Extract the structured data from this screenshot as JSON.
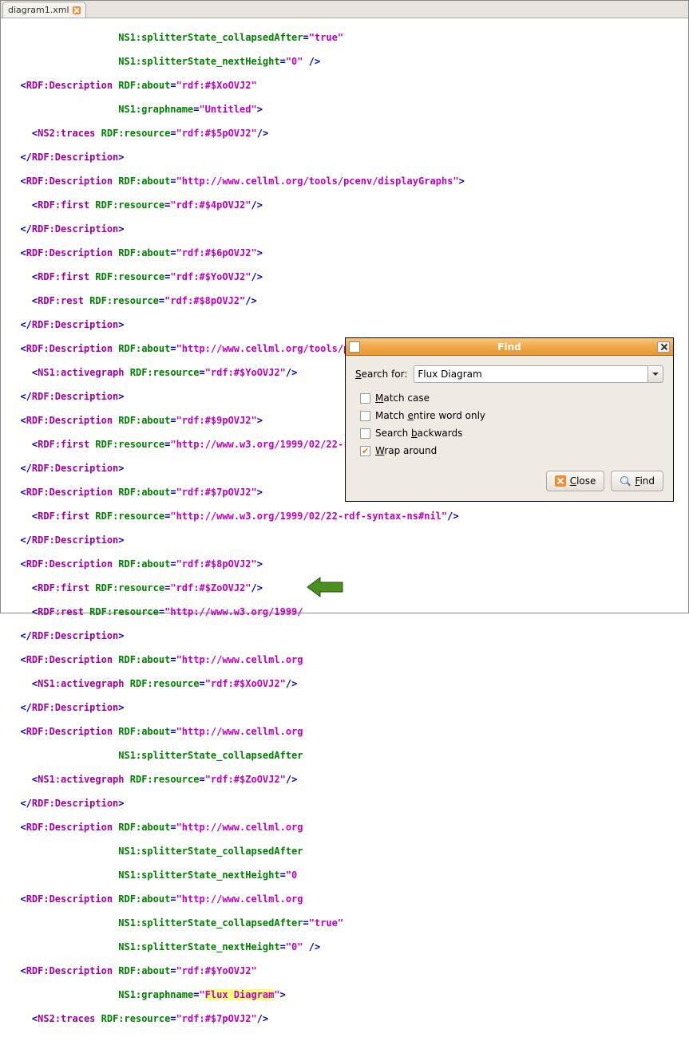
{
  "tab": {
    "label": "diagram1.xml"
  },
  "code": {
    "l1_a": "NS1:splitterState_collapsedAfter",
    "l1_v": "\"true\"",
    "l2_a": "NS1:splitterState_nextHeight",
    "l2_v": "\"0\"",
    "l3_t": "RDF:Description",
    "l3_a": "RDF:about",
    "l3_v": "\"rdf:#$XoOVJ2\"",
    "l4_a": "NS1:graphname",
    "l4_v": "\"Untitled\"",
    "l5_t": "NS2:traces",
    "l5_a": "RDF:resource",
    "l5_v": "\"rdf:#$5pOVJ2\"",
    "l6_t": "RDF:Description",
    "l7_t": "RDF:Description",
    "l7_a": "RDF:about",
    "l7_v": "\"http://www.cellml.org/tools/pcenv/displayGraphs\"",
    "l8_t": "RDF:first",
    "l8_a": "RDF:resource",
    "l8_v": "\"rdf:#$4pOVJ2\"",
    "l9_t": "RDF:Description",
    "l10_t": "RDF:Description",
    "l10_a": "RDF:about",
    "l10_v": "\"rdf:#$6pOVJ2\"",
    "l11_t": "RDF:first",
    "l11_a": "RDF:resource",
    "l11_v": "\"rdf:#$YoOVJ2\"",
    "l12_t": "RDF:rest",
    "l12_a": "RDF:resource",
    "l12_v": "\"rdf:#$8pOVJ2\"",
    "l13_t": "RDF:Description",
    "l14_t": "RDF:Description",
    "l14_a": "RDF:about",
    "l14_v": "\"http://www.cellml.org/tools/pcenv/splitter/graph_sel_graph2\"",
    "l15_t": "NS1:activegraph",
    "l15_a": "RDF:resource",
    "l15_v": "\"rdf:#$YoOVJ2\"",
    "l16_t": "RDF:Description",
    "l17_t": "RDF:Description",
    "l17_a": "RDF:about",
    "l17_v": "\"rdf:#$9pOVJ2\"",
    "l18_t": "RDF:first",
    "l18_a": "RDF:resource",
    "l18_v": "\"http://www.w3.org/1999/02/22-rdf-syntax-ns#nil\"",
    "l19_t": "RDF:Description",
    "l20_t": "RDF:Description",
    "l20_a": "RDF:about",
    "l20_v": "\"rdf:#$7pOVJ2\"",
    "l21_t": "RDF:first",
    "l21_a": "RDF:resource",
    "l21_v": "\"http://www.w3.org/1999/02/22-rdf-syntax-ns#nil\"",
    "l22_t": "RDF:Description",
    "l23_t": "RDF:Description",
    "l23_a": "RDF:about",
    "l23_v": "\"rdf:#$8pOVJ2\"",
    "l24_t": "RDF:first",
    "l24_a": "RDF:resource",
    "l24_v": "\"rdf:#$ZoOVJ2\"",
    "l25_t": "RDF:rest",
    "l25_a": "RDF:resource",
    "l25_v": "\"http://www.w3.org/1999/",
    "l26_t": "RDF:Description",
    "l27_t": "RDF:Description",
    "l27_a": "RDF:about",
    "l27_v": "\"http://www.cellml.org",
    "l28_t": "NS1:activegraph",
    "l28_a": "RDF:resource",
    "l28_v": "\"rdf:#$XoOVJ2\"",
    "l29_t": "RDF:Description",
    "l30_t": "RDF:Description",
    "l30_a": "RDF:about",
    "l30_v": "\"http://www.cellml.org",
    "l31_a": "NS1:splitterState_collapsedAfter",
    "l32_t": "NS1:activegraph",
    "l32_a": "RDF:resource",
    "l32_v": "\"rdf:#$ZoOVJ2\"",
    "l33_t": "RDF:Description",
    "l34_t": "RDF:Description",
    "l34_a": "RDF:about",
    "l34_v": "\"http://www.cellml.org",
    "l35_a": "NS1:splitterState_collapsedAfter",
    "l36_a": "NS1:splitterState_nextHeight",
    "l36_v": "\"0",
    "l37_t": "RDF:Description",
    "l37_a": "RDF:about",
    "l37_v": "\"http://www.cellml.org",
    "l38_a": "NS1:splitterState_collapsedAfter",
    "l38_v": "\"true\"",
    "l39_a": "NS1:splitterState_nextHeight",
    "l39_v": "\"0\"",
    "l40_t": "RDF:Description",
    "l40_a": "RDF:about",
    "l40_v": "\"rdf:#$YoOVJ2\"",
    "l41_a": "NS1:graphname",
    "l41_v1": "\"",
    "l41_hl": "Flux Diagram",
    "l41_v2": "\"",
    "l42_t": "NS2:traces",
    "l42_a": "RDF:resource",
    "l42_v": "\"rdf:#$7pOVJ2\""
  },
  "find": {
    "title": "Find",
    "search_label": "Search for:",
    "search_value": "Flux Diagram",
    "match_case": "Match case",
    "match_word": "Match entire word only",
    "backwards": "Search backwards",
    "wrap": "Wrap around",
    "close": "Close",
    "find_btn": "Find"
  }
}
